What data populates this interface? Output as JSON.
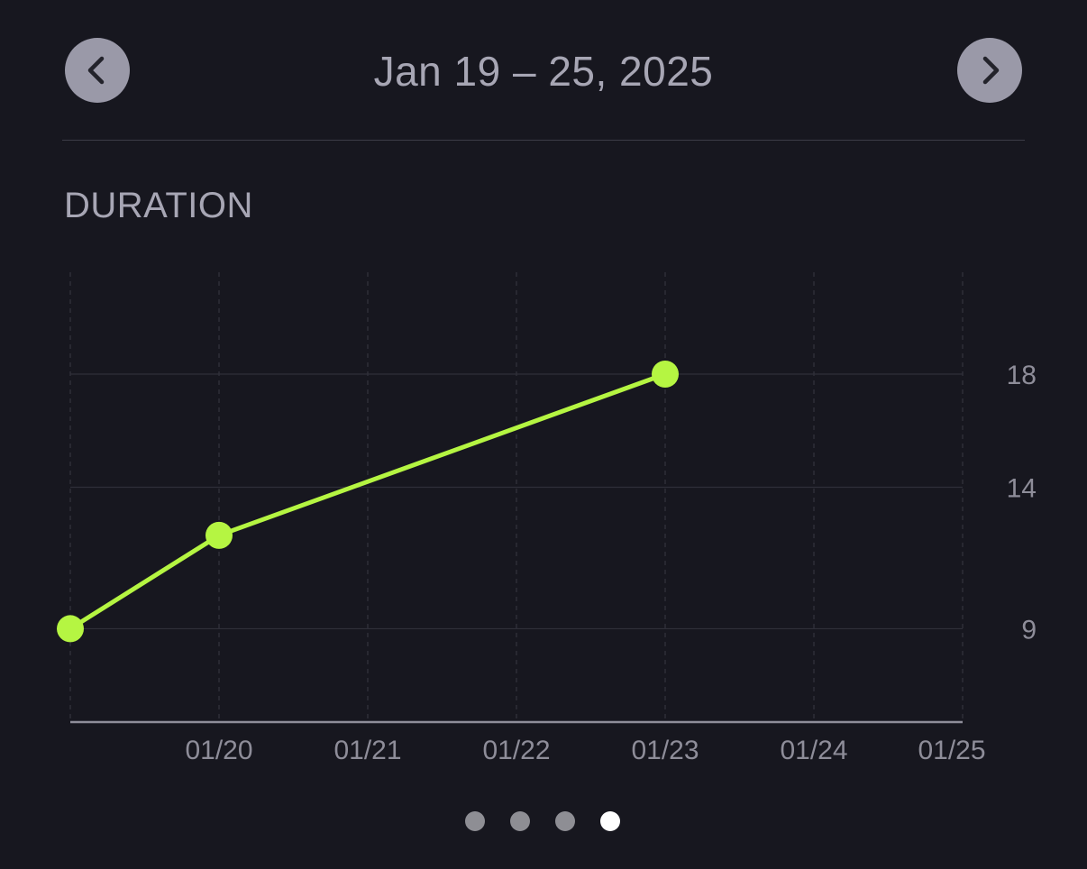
{
  "header": {
    "date_range": "Jan 19 – 25, 2025",
    "prev_icon": "chevron-left-icon",
    "next_icon": "chevron-right-icon"
  },
  "section": {
    "title": "DURATION"
  },
  "chart_data": {
    "type": "line",
    "title": "",
    "xlabel": "",
    "ylabel": "",
    "x_ticks": [
      "01/20",
      "01/21",
      "01/22",
      "01/23",
      "01/24",
      "01/25"
    ],
    "y_ticks": [
      9,
      14,
      18
    ],
    "x_domain": [
      "01/19",
      "01/25"
    ],
    "series": [
      {
        "color": "#b5f542",
        "points": [
          {
            "x": "01/19",
            "y": 9
          },
          {
            "x": "01/20",
            "y": 12.3
          },
          {
            "x": "01/23",
            "y": 18
          }
        ]
      }
    ],
    "ylim": [
      5.7,
      21.6
    ],
    "grid": true,
    "y_axis_position": "right"
  },
  "pager": {
    "count": 4,
    "active_index": 3
  },
  "colors": {
    "background": "#17171f",
    "accent": "#b5f542",
    "text_muted": "#a7a6b4",
    "button_bg": "#9a99a8"
  }
}
